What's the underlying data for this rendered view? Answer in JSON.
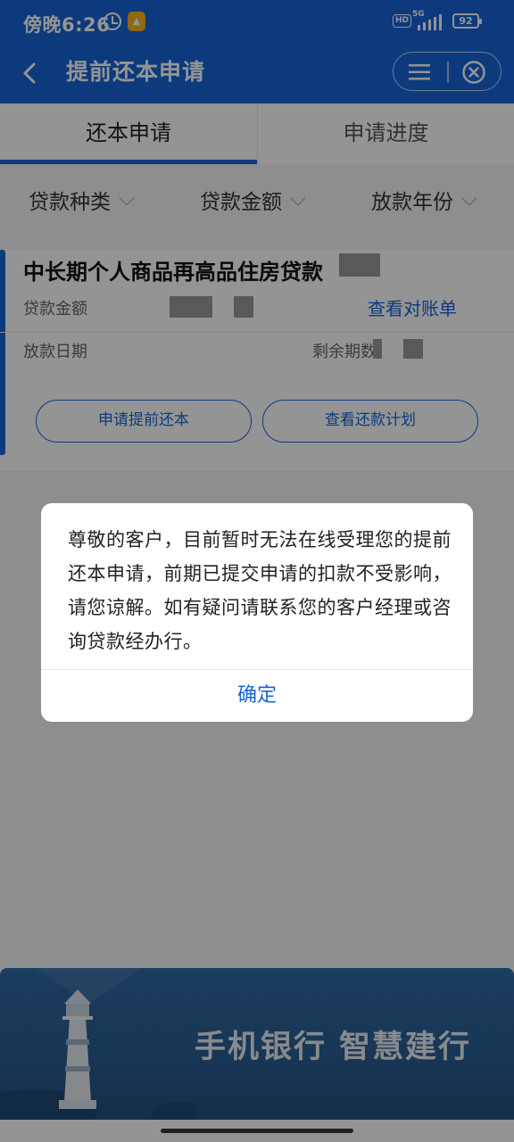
{
  "status_bar": {
    "time": "傍晚6:26",
    "app_badge": "▲",
    "hd": "HD",
    "network": "5G",
    "battery": "92"
  },
  "nav": {
    "title": "提前还本申请"
  },
  "tabs": [
    {
      "label": "还本申请",
      "active": true
    },
    {
      "label": "申请进度",
      "active": false
    }
  ],
  "filters": [
    {
      "label": "贷款种类"
    },
    {
      "label": "贷款金额"
    },
    {
      "label": "放款年份"
    }
  ],
  "loan_card": {
    "title": "中长期个人商品再高品住房贷款",
    "amount_label": "贷款金额",
    "bill_link": "查看对账单",
    "disburse_label": "放款日期",
    "remaining_label": "剩余期数",
    "apply_button": "申请提前还本",
    "plan_button": "查看还款计划"
  },
  "dialog": {
    "message": "尊敬的客户，目前暂时无法在线受理您的提前还本申请，前期已提交申请的扣款不受影响，请您谅解。如有疑问请联系您的客户经理或咨询贷款经办行。",
    "confirm": "确定"
  },
  "banner": {
    "slogan_left": "手机银行",
    "slogan_right": "智慧建行"
  },
  "colors": {
    "primary": "#1565d8",
    "overlay": "rgba(0,0,0,0.42)"
  }
}
